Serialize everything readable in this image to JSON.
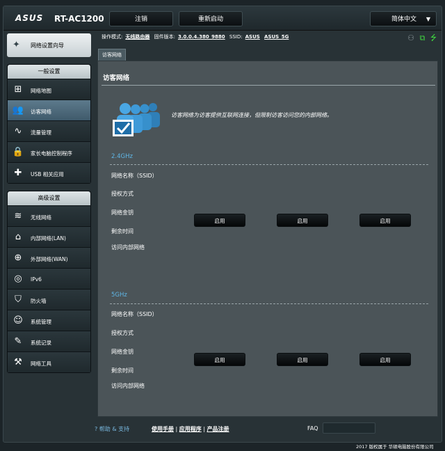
{
  "header": {
    "logo": "ASUS",
    "model": "RT-AC1200",
    "logout_label": "注销",
    "reboot_label": "重新启动",
    "language": "简体中文"
  },
  "status": {
    "mode_label": "操作模式:",
    "mode_value": "无线路由器",
    "fw_label": "固件版本:",
    "fw_value": "3.0.0.4.380_9880",
    "ssid_label": "SSID:",
    "ssid_1": "ASUS",
    "ssid_2": "ASUS_5G"
  },
  "sidebar": {
    "wizard_label": "网络设置向导",
    "general_heading": "一般设置",
    "general_items": [
      {
        "label": "网络地图",
        "icon": "network-map-icon"
      },
      {
        "label": "访客网络",
        "icon": "guest-network-icon"
      },
      {
        "label": "流量管理",
        "icon": "traffic-icon"
      },
      {
        "label": "家长电脑控制程序",
        "icon": "lock-icon"
      },
      {
        "label": "USB 相关应用",
        "icon": "puzzle-icon"
      }
    ],
    "advanced_heading": "高级设置",
    "advanced_items": [
      {
        "label": "无线网络",
        "icon": "wifi-icon"
      },
      {
        "label": "内部网络(LAN)",
        "icon": "home-icon"
      },
      {
        "label": "外部网络(WAN)",
        "icon": "globe-icon"
      },
      {
        "label": "IPv6",
        "icon": "ipv6-icon"
      },
      {
        "label": "防火墙",
        "icon": "shield-icon"
      },
      {
        "label": "系统管理",
        "icon": "user-icon"
      },
      {
        "label": "系统记录",
        "icon": "log-icon"
      },
      {
        "label": "网络工具",
        "icon": "tools-icon"
      }
    ]
  },
  "main": {
    "tab_label": "访客网络",
    "title": "访客网络",
    "description": "访客网络为访客提供互联网连接，但限制访客访问您的内部网络。",
    "band_24": "2.4GHz",
    "band_5": "5GHz",
    "fields": [
      "网络名称（SSID）",
      "授权方式",
      "网络金钥",
      "剩余时间",
      "访问内部网络"
    ],
    "enable_label": "启用"
  },
  "footer": {
    "help": "帮助 & 支持",
    "manual": "使用手册",
    "utility": "应用程序",
    "register": "产品注册",
    "faq": "FAQ",
    "copyright": "2017 版权属于 华硕电脑股份有限公司"
  },
  "colors": {
    "accent": "#5fb6e6",
    "background": "#283236",
    "panel": "#4b5458"
  }
}
